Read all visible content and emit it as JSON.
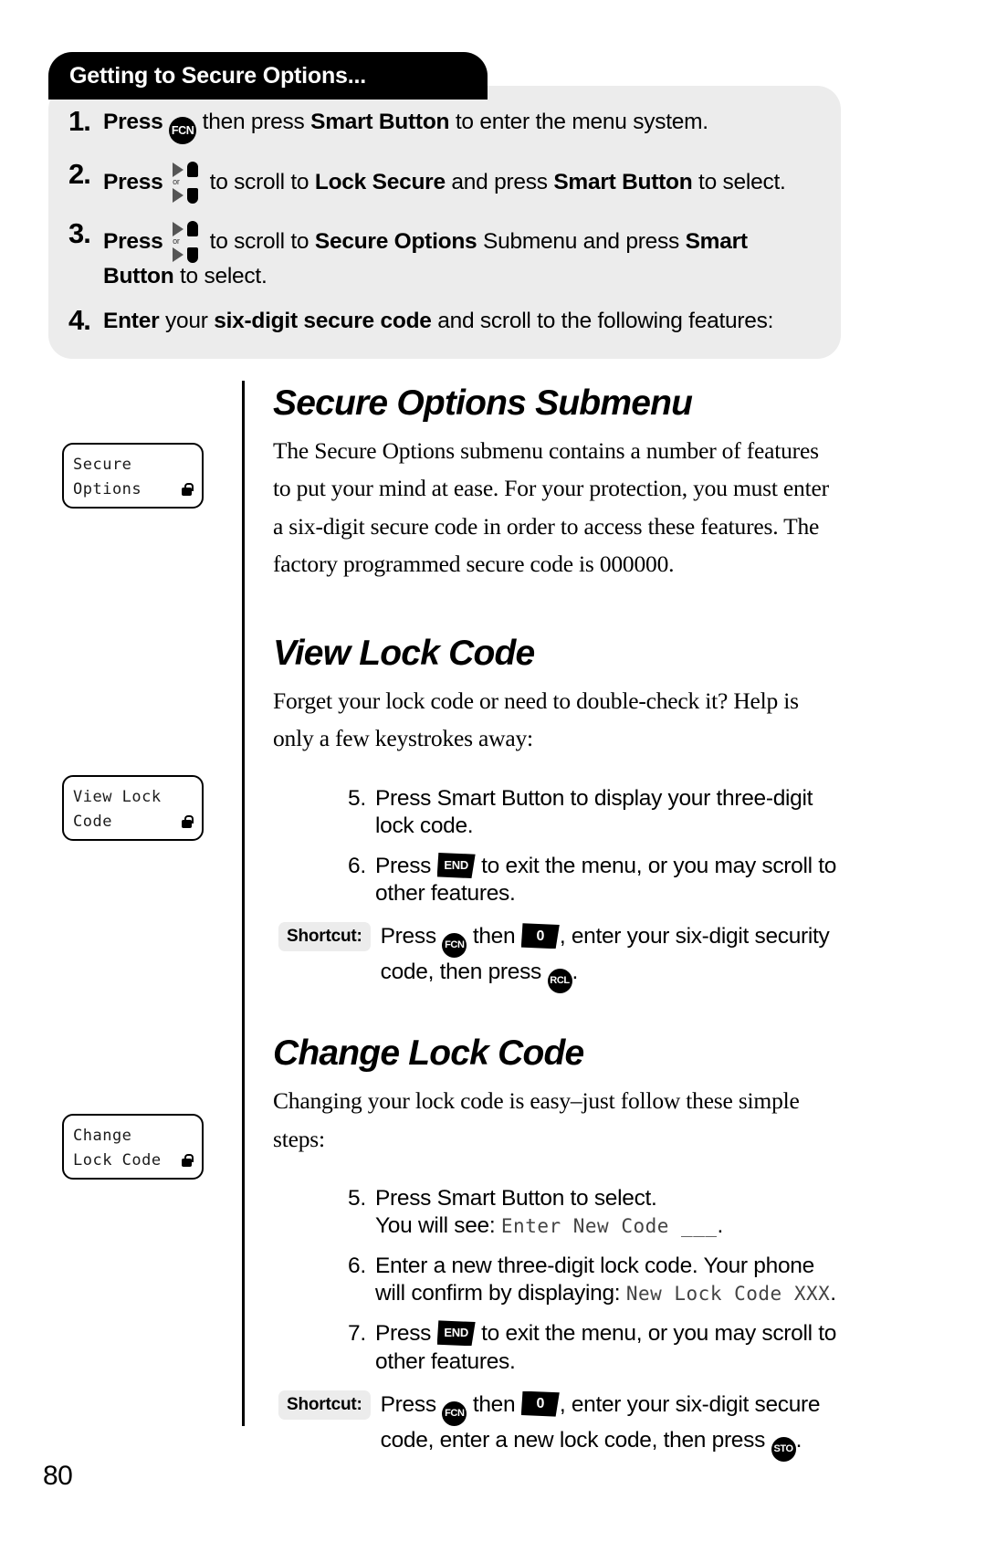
{
  "page": {
    "number": "80"
  },
  "callout": {
    "title": "Getting to Secure Options...",
    "steps": [
      {
        "num": "1.",
        "lead": "Press",
        "key": "FCN",
        "key_type": "round",
        "rest_1": "then press",
        "bold_1": "Smart Button",
        "rest_2": "to enter the menu system."
      },
      {
        "num": "2.",
        "lead": "Press",
        "key": "scroll-icon",
        "key_type": "scroll",
        "rest_1": "to scroll to",
        "bold_1": "Lock Secure",
        "rest_2": "and press",
        "bold_2": "Smart Button",
        "rest_3": "to select."
      },
      {
        "num": "3.",
        "lead": "Press",
        "key": "scroll-icon",
        "key_type": "scroll",
        "rest_1": "to scroll to",
        "bold_1": "Secure Options",
        "rest_2": "Submenu and press",
        "bold_2": "Smart Button",
        "rest_3": "to select."
      },
      {
        "num": "4.",
        "bold_lead": "Enter",
        "rest_1": "your",
        "bold_1": "six-digit secure code",
        "rest_2": "and scroll to the following features:"
      }
    ]
  },
  "lcd_screens": [
    {
      "line1": "Secure",
      "line2": "Options",
      "lock": "lock-icon"
    },
    {
      "line1": "View Lock",
      "line2": "Code",
      "lock": "lock-icon"
    },
    {
      "line1": "Change",
      "line2": "Lock Code",
      "lock": "lock-icon"
    }
  ],
  "sections": [
    {
      "heading": "Secure Options Submenu",
      "paragraph": "The Secure Options submenu contains a number of features to put your mind at ease. For your protection, you must enter a six-digit secure code in order to access these features. The factory programmed secure code is 000000."
    },
    {
      "heading": "View Lock Code",
      "paragraph": "Forget your lock code or need to double-check it? Help is only a few keystrokes away:",
      "steps": [
        {
          "n": "5.",
          "text": "Press Smart Button to display your three-digit lock code."
        },
        {
          "n": "6.",
          "pre": "Press",
          "key": "END",
          "post": "to exit the menu, or you may scroll to other features."
        }
      ],
      "shortcut": {
        "label": "Shortcut:",
        "pre": "Press",
        "key1": "FCN",
        "mid1": "then",
        "key2": "0",
        "mid2": ", enter your six-digit security code, then press",
        "key3": "RCL",
        "end": "."
      }
    },
    {
      "heading": "Change Lock Code",
      "paragraph": "Changing your lock code is easy–just follow these simple steps:",
      "steps": [
        {
          "n": "5.",
          "text": "Press Smart Button to select.",
          "text2": "You will see:",
          "lcd_text": "Enter New Code ___",
          "text3": "."
        },
        {
          "n": "6.",
          "text": "Enter a new three-digit lock code. Your phone will confirm by displaying:",
          "lcd_text": "New Lock Code XXX",
          "text3": "."
        },
        {
          "n": "7.",
          "pre": "Press",
          "key": "END",
          "post": "to exit the menu, or you may scroll to other features."
        }
      ],
      "shortcut": {
        "label": "Shortcut:",
        "pre": "Press",
        "key1": "FCN",
        "mid1": "then",
        "key2": "0",
        "mid2": ", enter your six-digit secure code, enter a new lock code, then press",
        "key3": "STO",
        "end": "."
      }
    }
  ],
  "colors": {
    "callout_bg": "#ececec",
    "title_bar": "#000000",
    "text": "#000000"
  }
}
